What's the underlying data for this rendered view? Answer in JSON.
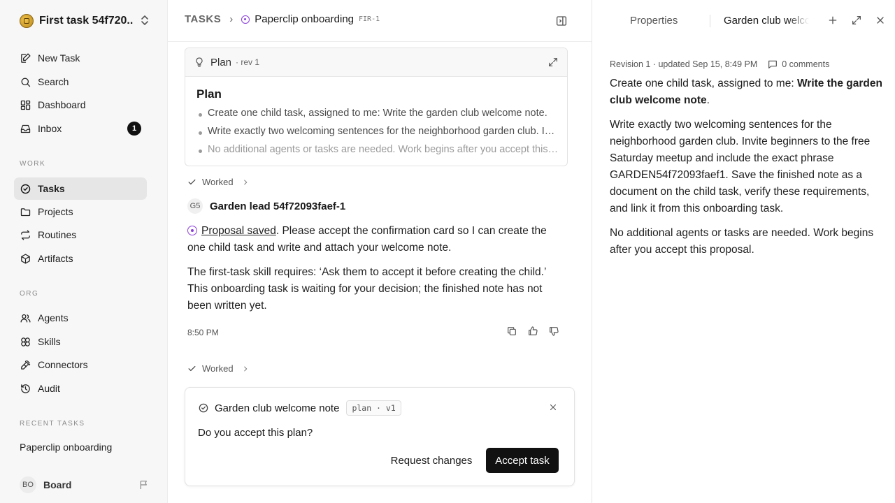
{
  "sidebar": {
    "workspace_name": "First task 54f720...",
    "nav_top": [
      {
        "label": "New Task",
        "icon": "edit-icon"
      },
      {
        "label": "Search",
        "icon": "search-icon"
      },
      {
        "label": "Dashboard",
        "icon": "dashboard-icon"
      },
      {
        "label": "Inbox",
        "icon": "inbox-icon",
        "badge": "1"
      }
    ],
    "work_heading": "WORK",
    "nav_work": [
      {
        "label": "Tasks",
        "icon": "check-circle-icon",
        "active": true
      },
      {
        "label": "Projects",
        "icon": "folder-icon"
      },
      {
        "label": "Routines",
        "icon": "repeat-icon"
      },
      {
        "label": "Artifacts",
        "icon": "box-icon"
      }
    ],
    "org_heading": "ORG",
    "nav_org": [
      {
        "label": "Agents",
        "icon": "users-icon"
      },
      {
        "label": "Skills",
        "icon": "skills-icon"
      },
      {
        "label": "Connectors",
        "icon": "plug-icon"
      },
      {
        "label": "Audit",
        "icon": "history-icon"
      }
    ],
    "recent_heading": "RECENT TASKS",
    "recent_items": [
      "Paperclip onboarding"
    ],
    "user": {
      "initials": "BO",
      "name": "Board"
    }
  },
  "header": {
    "root": "TASKS",
    "title": "Paperclip onboarding",
    "code": "FIR-1"
  },
  "plan_card": {
    "label": "Plan",
    "revision": "· rev 1",
    "heading": "Plan",
    "items": [
      "Create one child task, assigned to me: Write the garden club welcome note.",
      "Write exactly two welcoming sentences for the neighborhood garden club. Invite beginners to the free Saturday meetup.",
      "No additional agents or tasks are needed. Work begins after you accept this proposal."
    ]
  },
  "thread": {
    "worked_label": "Worked",
    "agent_initials": "G5",
    "agent_name": "Garden lead 54f72093faef-1",
    "link_text": "Proposal saved",
    "message_1_rest": ". Please accept the confirmation card so I can create the one child task and write and attach your welcome note.",
    "message_2": "The first-task skill requires: ‘Ask them to accept it before creating the child.’ This onboarding task is waiting for your decision; the finished note has not been written yet.",
    "time": "8:50 PM"
  },
  "confirmation": {
    "title": "Garden club welcome note",
    "tag": "plan · v1",
    "question": "Do you accept this plan?",
    "secondary_button": "Request changes",
    "primary_button": "Accept task"
  },
  "right_panel": {
    "tab_properties": "Properties",
    "tab_document": "Garden club welcome note",
    "meta": "Revision 1 · updated Sep 15, 8:49 PM",
    "comments": "0 comments",
    "p1_prefix": "Create one child task, assigned to me: ",
    "p1_bold": "Write the garden club welcome note",
    "p1_suffix": ".",
    "p2": "Write exactly two welcoming sentences for the neighborhood garden club. Invite beginners to the free Saturday meetup and include the exact phrase GARDEN54f72093faef1. Save the finished note as a document on the child task, verify these requirements, and link it from this onboarding task.",
    "p3": "No additional agents or tasks are needed. Work begins after you accept this proposal."
  }
}
